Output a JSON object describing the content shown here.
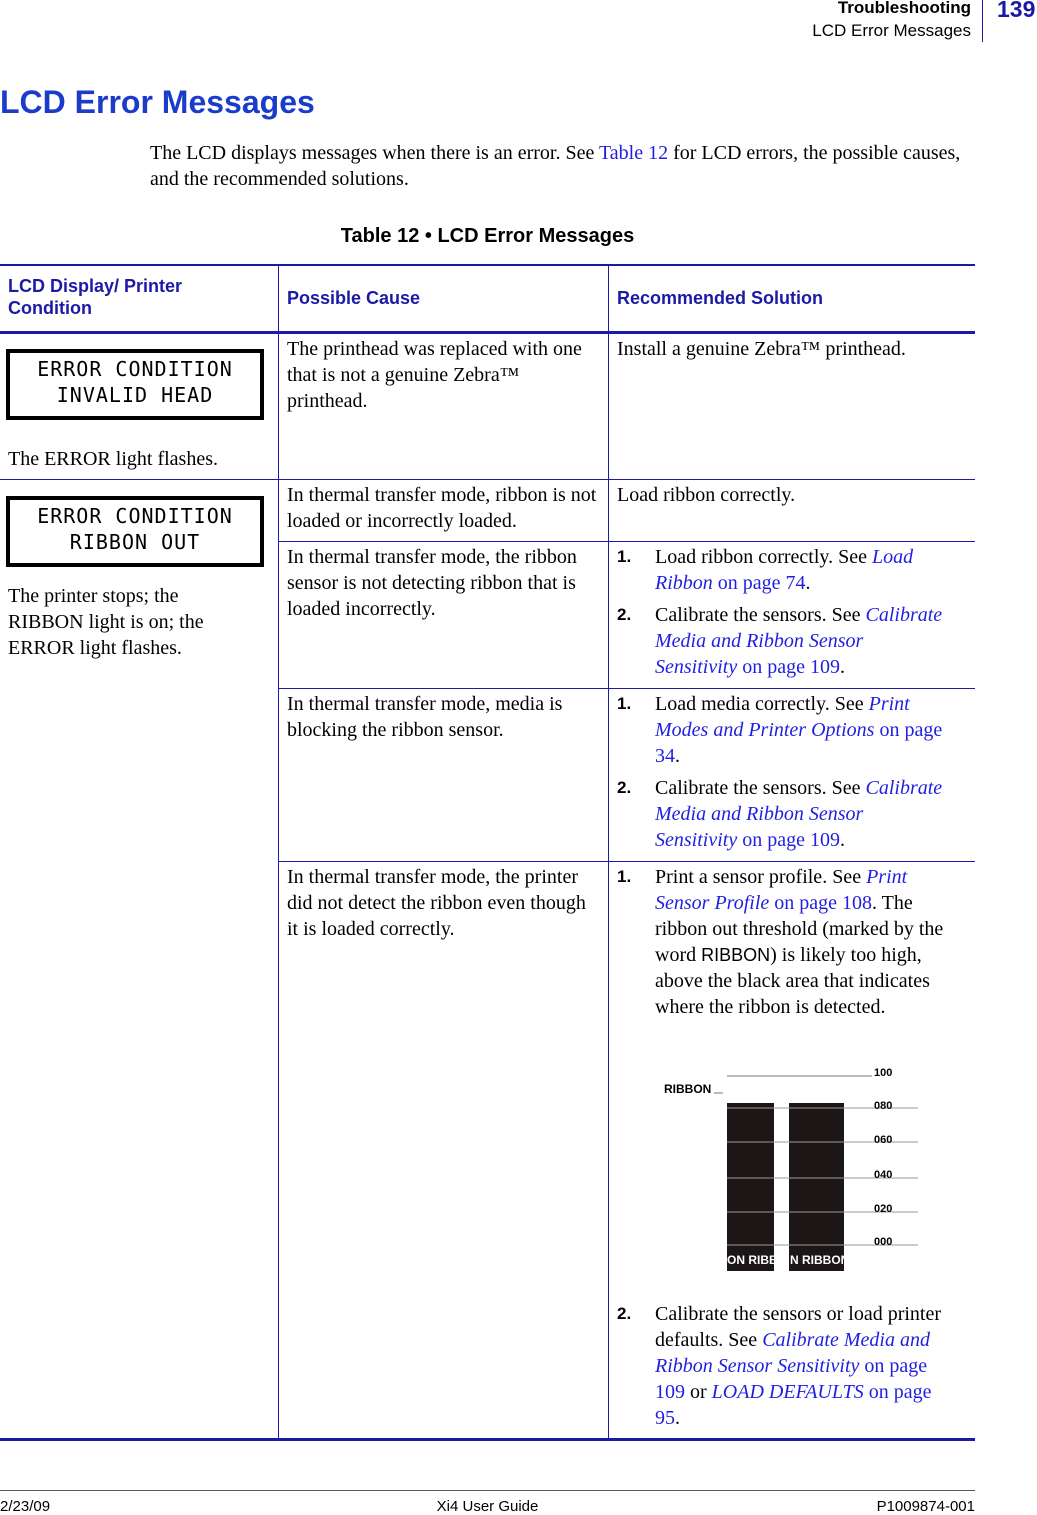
{
  "header": {
    "section": "Troubleshooting",
    "subsection": "LCD Error Messages",
    "page_number": "139"
  },
  "title": "LCD Error Messages",
  "intro": {
    "before": "The LCD displays messages when there is an error. See ",
    "link": "Table 12",
    "after": " for LCD errors, the possible causes, and the recommended solutions."
  },
  "table_caption": "Table 12 • LCD Error Messages",
  "columns": [
    "LCD Display/ Printer Condition",
    "Possible Cause",
    "Recommended Solution"
  ],
  "rows": [
    {
      "lcd": [
        "ERROR CONDITION",
        "INVALID HEAD"
      ],
      "condition": "The ERROR light flashes.",
      "cause": "The printhead was replaced with one that is not a genuine Zebra™ printhead.",
      "solution": "Install a genuine Zebra™ printhead."
    },
    {
      "lcd": [
        "ERROR CONDITION",
        "RIBBON OUT"
      ],
      "condition": "The printer stops; the RIBBON light is on; the ERROR light flashes.",
      "causes": [
        {
          "cause": "In thermal transfer mode, ribbon is not loaded or incorrectly loaded.",
          "solution": "Load ribbon correctly."
        },
        {
          "cause": "In thermal transfer mode, the ribbon sensor is not detecting ribbon that is loaded incorrectly.",
          "steps": [
            {
              "n": "1.",
              "text": "Load ribbon correctly. See ",
              "link_i": "Load Ribbon",
              "link": " on page 74",
              "end": "."
            },
            {
              "n": "2.",
              "text": "Calibrate the sensors. See ",
              "link_i": "Calibrate Media and Ribbon Sensor Sensitivity",
              "link": " on page 109",
              "end": "."
            }
          ]
        },
        {
          "cause": "In thermal transfer mode, media is blocking the ribbon sensor.",
          "steps": [
            {
              "n": "1.",
              "text": "Load media correctly. See ",
              "link_i": "Print Modes and Printer Options",
              "link": " on page 34",
              "end": "."
            },
            {
              "n": "2.",
              "text": "Calibrate the sensors. See ",
              "link_i": "Calibrate Media and Ribbon Sensor Sensitivity",
              "link": " on page 109",
              "end": "."
            }
          ]
        },
        {
          "cause": "In thermal transfer mode, the printer did not detect the ribbon even though it is loaded correctly.",
          "step1": {
            "n": "1.",
            "text": "Print a sensor profile. See ",
            "link_i": "Print Sensor Profile",
            "link": " on page 108",
            "end": ". The ribbon out threshold (marked by the word ",
            "mono": "RIBBON",
            "end2": ") is likely too high, above the black area that indicates where the ribbon is detected."
          },
          "step2": {
            "n": "2.",
            "text": "Calibrate the sensors or load printer defaults. See ",
            "link_i": "Calibrate Media and Ribbon Sensor Sensitivity",
            "link": " on page 109",
            "mid": " or ",
            "link2_i": "LOAD DEFAULTS",
            "link2": " on page 95",
            "end": "."
          }
        }
      ]
    }
  ],
  "sensor_profile": {
    "threshold_label": "RIBBON",
    "scale": [
      "100",
      "080",
      "060",
      "040",
      "020",
      "000"
    ],
    "bar_labels": [
      "ON RIBB",
      "N RIBBON"
    ]
  },
  "footer": {
    "date": "2/23/09",
    "guide": "Xi4 User Guide",
    "part": "P1009874-001"
  }
}
